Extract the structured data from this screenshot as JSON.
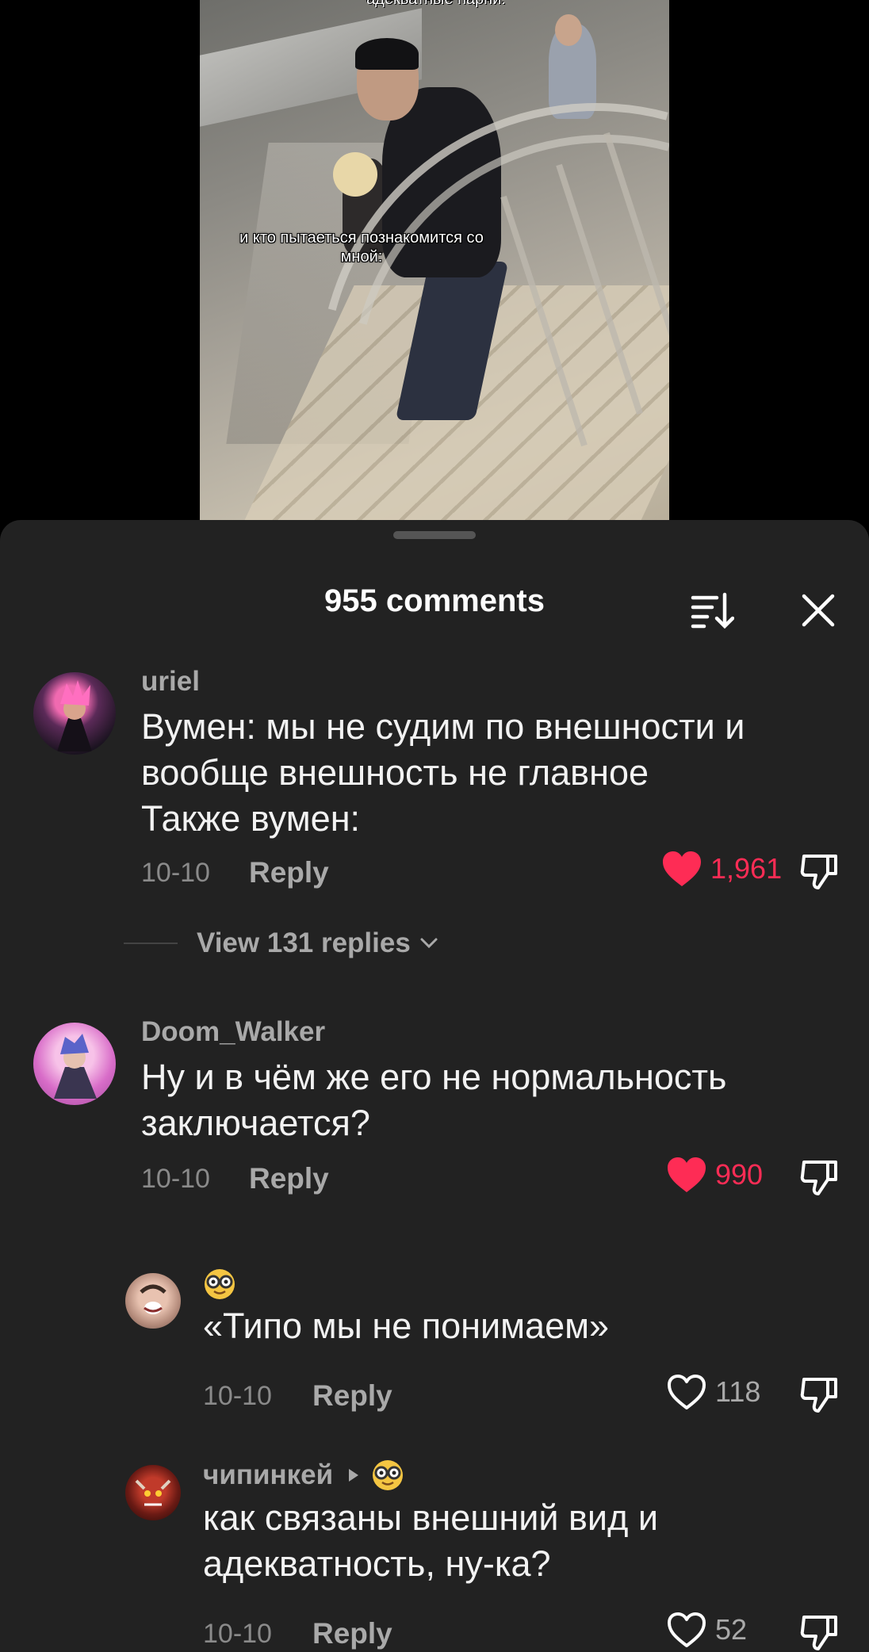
{
  "video": {
    "top_caption": "адекватные парни:",
    "caption": "и кто пытаеться познакомится со мной:"
  },
  "sheet": {
    "title": "955 comments"
  },
  "comments": [
    {
      "username": "uriel",
      "text_lines": [
        "Вумен: мы не судим по внешности и",
        "вообще внешность не главное",
        "Также вумен:"
      ],
      "date": "10-10",
      "reply_label": "Reply",
      "likes": "1,961",
      "liked": true,
      "view_replies": "View 131 replies"
    },
    {
      "username": "Doom_Walker",
      "text_lines": [
        "Ну и в чём же его не нормальность",
        "заключается?"
      ],
      "date": "10-10",
      "reply_label": "Reply",
      "likes": "990",
      "liked": true
    }
  ],
  "replies": [
    {
      "username": "",
      "text": "«Типо мы не понимаем»",
      "date": "10-10",
      "reply_label": "Reply",
      "likes": "118",
      "liked": false
    },
    {
      "username": "чипинкей",
      "text_lines": [
        "как связаны внешний вид и",
        "адекватность, ну-ка?"
      ],
      "date": "10-10",
      "reply_label": "Reply",
      "likes": "52",
      "liked": false
    }
  ],
  "colors": {
    "accent_like": "#fe2c55",
    "sheet_bg": "#222222",
    "muted_text": "#a9a9a9"
  },
  "icons": {
    "sort": "sort-icon",
    "close": "close-icon",
    "heart_filled": "heart-filled-icon",
    "heart_outline": "heart-outline-icon",
    "dislike": "dislike-icon",
    "chevron": "chevron-down-icon",
    "glasses_emoji": "nerd-glasses-emoji-icon"
  }
}
